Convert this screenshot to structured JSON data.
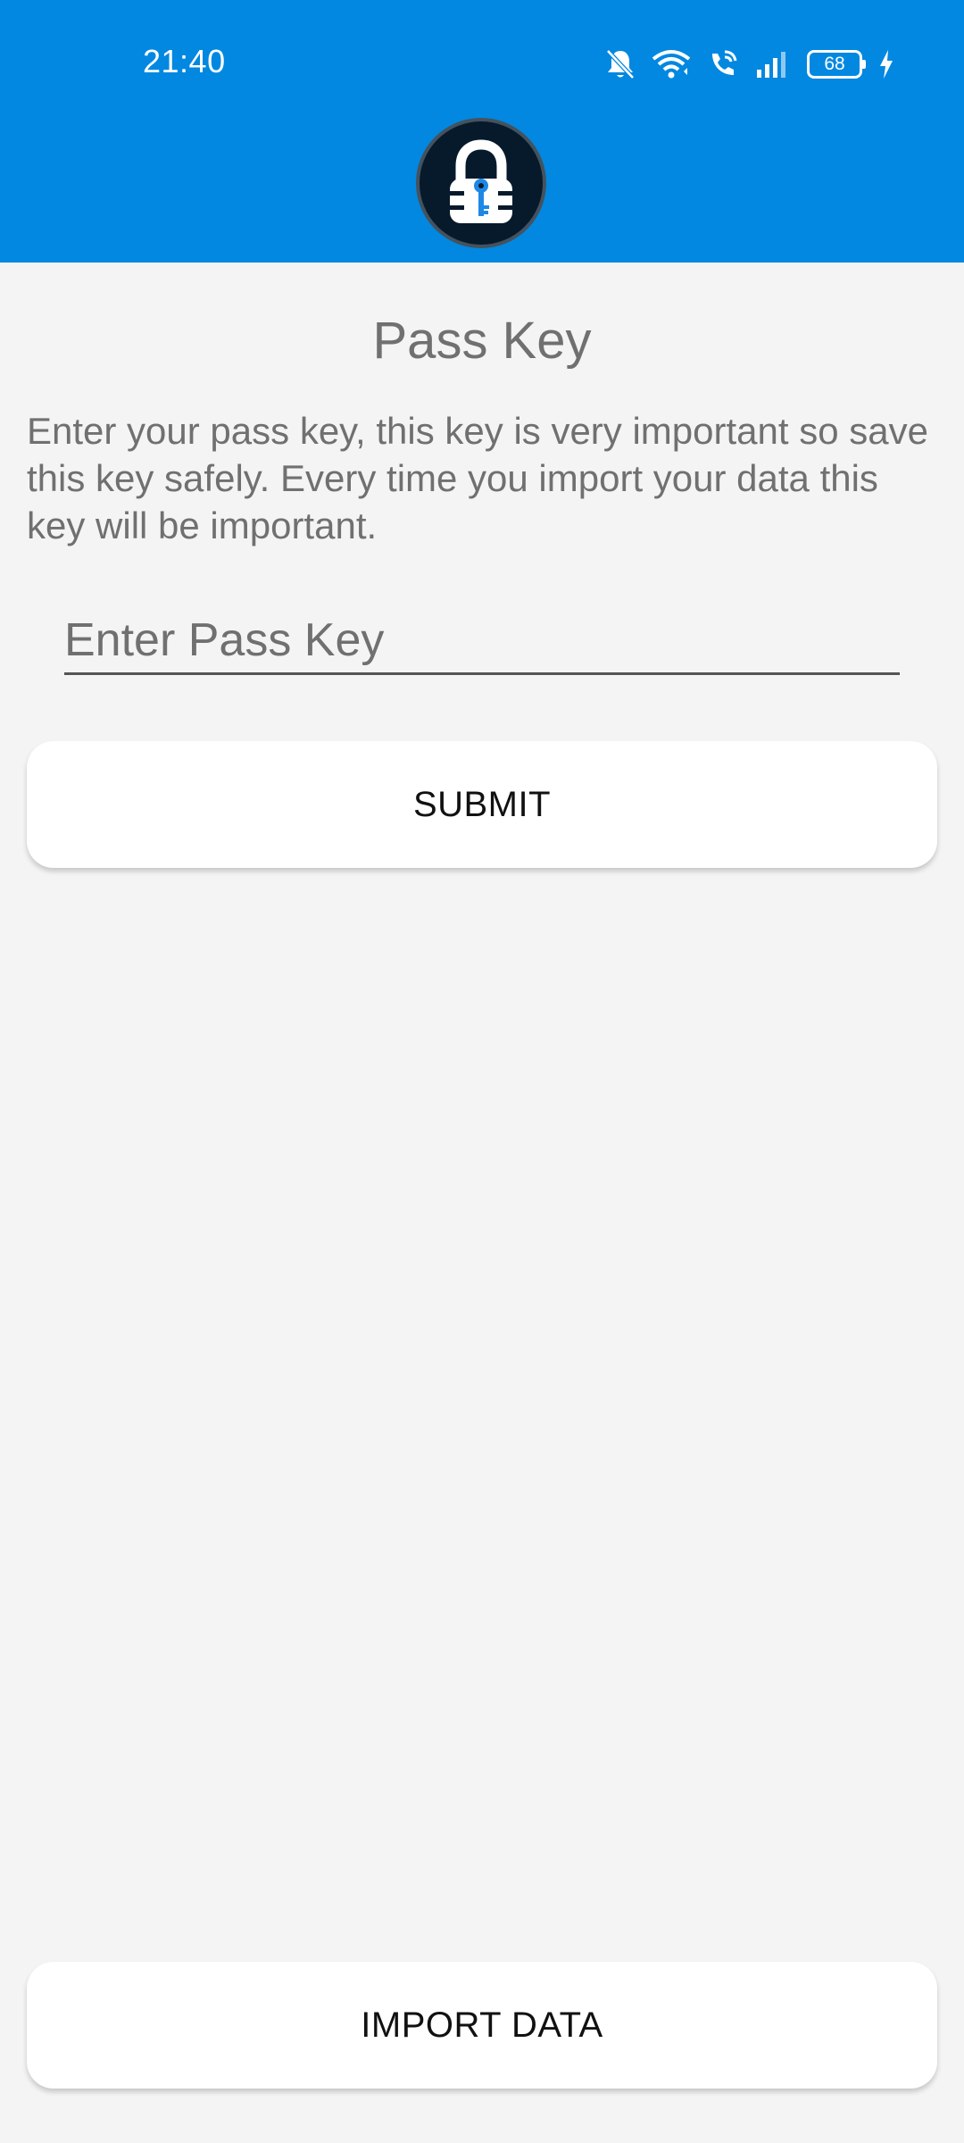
{
  "status_bar": {
    "time": "21:40",
    "battery_level": "68",
    "icons": [
      "bell-muted-icon",
      "wifi-icon",
      "wifi-call-icon",
      "signal-icon",
      "battery-icon",
      "charging-icon"
    ]
  },
  "header": {
    "color": "#0288e0",
    "logo": "lock-key-icon"
  },
  "main": {
    "title": "Pass Key",
    "description": "Enter your pass key, this key is very important so save this key safely. Every time you import your data this key will be important.",
    "pass_key_input": {
      "value": "",
      "placeholder": "Enter Pass Key"
    },
    "submit_label": "SUBMIT"
  },
  "footer": {
    "import_label": "IMPORT DATA"
  },
  "colors": {
    "background": "#f4f4f4",
    "accent": "#0288e0",
    "text_muted": "#707070"
  }
}
